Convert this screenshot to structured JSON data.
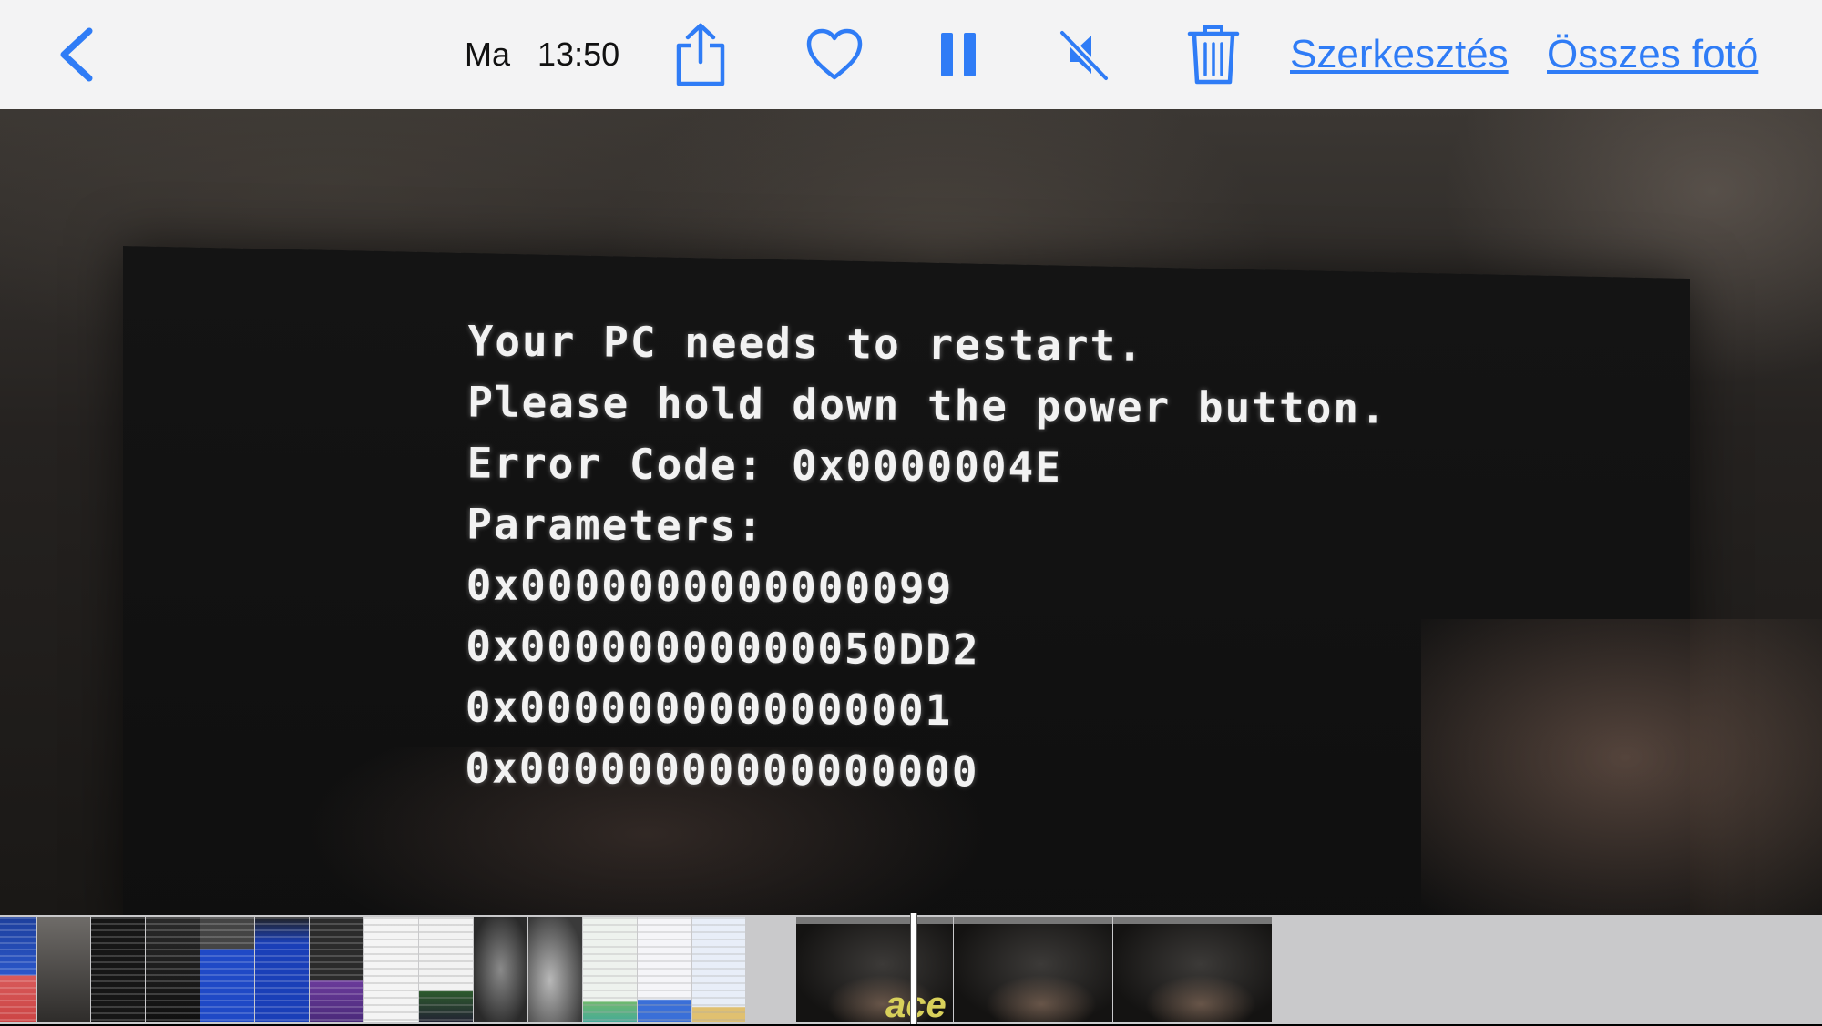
{
  "toolbar": {
    "day": "Ma",
    "time": "13:50",
    "edit_label": "Szerkesztés",
    "all_photos_label": "Összes fotó",
    "accent": "#2f7cf6",
    "icons": [
      "chevron-left-icon",
      "share-icon",
      "heart-icon",
      "pause-icon",
      "speaker-muted-icon",
      "trash-icon"
    ]
  },
  "photo": {
    "lines": [
      "Your PC needs to restart.",
      "Please hold down the power button.",
      "Error Code: 0x0000004E",
      "Parameters:",
      "0x0000000000000099",
      "0x00000000000050DD2",
      "0x0000000000000001",
      "0x00000000000000000"
    ]
  },
  "filmstrip": {
    "acer_logo_text": "ace"
  }
}
